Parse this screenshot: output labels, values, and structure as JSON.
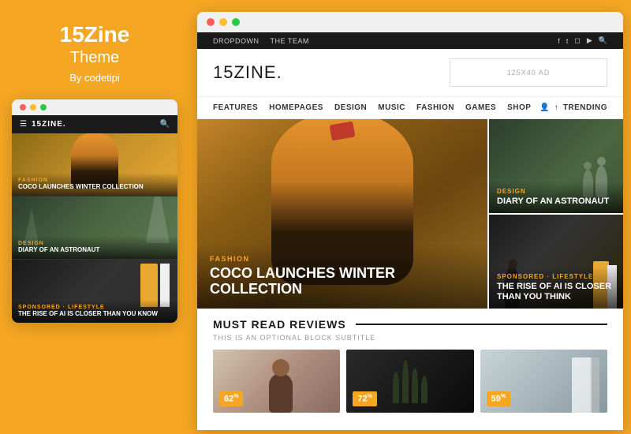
{
  "left_panel": {
    "brand_name": "15Zine",
    "brand_subtitle": "Theme",
    "brand_author": "By codetipi"
  },
  "mini_browser": {
    "logo": "15ZINE.",
    "cards": [
      {
        "category": "FASHION",
        "title": "COCO LAUNCHES WINTER COLLECTION"
      },
      {
        "category": "DESIGN",
        "title": "DIARY OF AN ASTRONAUT"
      },
      {
        "category": "SPONSORED · LIFESTYLE",
        "title": "THE RISE OF AI IS CLOSER THAN YOU KNOW"
      }
    ]
  },
  "main_browser": {
    "top_nav": {
      "links": [
        "DROPDOWN",
        "THE TEAM"
      ],
      "icons": [
        "f",
        "t",
        "g",
        "yt",
        "🔍"
      ]
    },
    "header": {
      "logo": "15ZINE.",
      "ad_text": "125x40 AD"
    },
    "main_nav": {
      "links": [
        "FEATURES",
        "HOMEPAGES",
        "DESIGN",
        "MUSIC",
        "FASHION",
        "GAMES",
        "SHOP"
      ],
      "trending": "TRENDING"
    },
    "hero": {
      "main_article": {
        "category": "FASHION",
        "title": "COCO LAUNCHES WINTER COLLECTION"
      },
      "side_articles": [
        {
          "category": "DESIGN",
          "title": "DIARY OF AN ASTRONAUT"
        },
        {
          "category": "SPONSORED · LIFESTYLE",
          "title": "THE RISE OF AI IS CLOSER THAN YOU THINK"
        }
      ]
    },
    "must_read": {
      "title": "MUST READ REVIEWS",
      "subtitle": "THIS IS AN OPTIONAL BLOCK SUBTITLE",
      "cards": [
        {
          "score": "62",
          "suffix": "%"
        },
        {
          "score": "72",
          "suffix": "%"
        },
        {
          "score": "59",
          "suffix": "%"
        }
      ]
    }
  },
  "colors": {
    "orange": "#F5A623",
    "dark": "#1a1a1a",
    "white": "#ffffff"
  }
}
